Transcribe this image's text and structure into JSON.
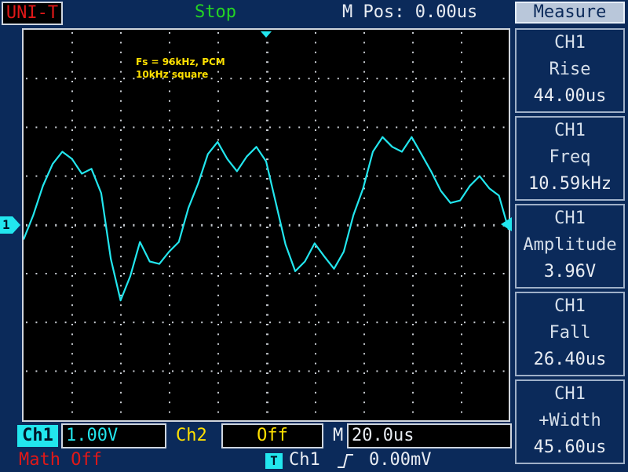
{
  "header": {
    "brand": "UNI-T",
    "run_status": "Stop",
    "horizontal_position": "M Pos: 0.00us"
  },
  "annotation": {
    "line1": "Fs = 96kHz, PCM",
    "line2": "10kHz square"
  },
  "markers": {
    "channel_ground": "1"
  },
  "measure_menu": {
    "title": "Measure",
    "items": [
      {
        "channel": "CH1",
        "name": "Rise",
        "value": "44.00us"
      },
      {
        "channel": "CH1",
        "name": "Freq",
        "value": "10.59kHz"
      },
      {
        "channel": "CH1",
        "name": "Amplitude",
        "value": "3.96V"
      },
      {
        "channel": "CH1",
        "name": "Fall",
        "value": "26.40us"
      },
      {
        "channel": "CH1",
        "name": "+Width",
        "value": "45.60us"
      }
    ]
  },
  "status_bar": {
    "ch1_label": "Ch1",
    "ch1_scale": "1.00V",
    "ch2_label": "Ch2",
    "ch2_scale": "Off",
    "timebase_label": "M",
    "timebase": "20.0us",
    "math": "Math Off",
    "trigger_badge": "T",
    "trigger_source": "Ch1",
    "trigger_level": "0.00mV"
  },
  "colors": {
    "background": "#0b2a5a",
    "trace": "#22e6ee",
    "ch2": "#ffe000",
    "run_status": "#23d423",
    "brand": "#e01818"
  },
  "chart_data": {
    "type": "line",
    "x": [
      0,
      5,
      10,
      15,
      20,
      25,
      30,
      35,
      40,
      45,
      50,
      55,
      60,
      65,
      70,
      75,
      80,
      85,
      90,
      95,
      100,
      105,
      110,
      115,
      120,
      125,
      130,
      135,
      140,
      145,
      150,
      155,
      160,
      165,
      170,
      175,
      180,
      185,
      190,
      195,
      200,
      205,
      210,
      215,
      220,
      225,
      230,
      235,
      240,
      245,
      250
    ],
    "series": [
      {
        "values": [
          -0.3,
          0.2,
          0.8,
          1.25,
          1.5,
          1.35,
          1.05,
          1.15,
          0.65,
          -0.7,
          -1.55,
          -1.05,
          -0.35,
          -0.75,
          -0.8,
          -0.55,
          -0.35,
          0.35,
          0.85,
          1.45,
          1.7,
          1.35,
          1.1,
          1.4,
          1.6,
          1.3,
          0.45,
          -0.4,
          -0.95,
          -0.75,
          -0.38,
          -0.65,
          -0.9,
          -0.55,
          0.2,
          0.75,
          1.5,
          1.8,
          1.6,
          1.5,
          1.8,
          1.45,
          1.1,
          0.7,
          0.45,
          0.5,
          0.8,
          1.0,
          0.75,
          0.6,
          -0.1
        ]
      }
    ],
    "xlim": [
      0,
      250
    ],
    "ylim": [
      -2,
      2
    ],
    "grid": true
  }
}
